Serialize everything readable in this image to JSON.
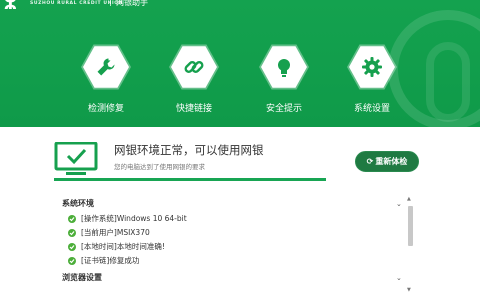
{
  "header": {
    "logo_text": "SUZHOU RURAL CREDIT UNION",
    "subtitle": "网银助手",
    "colors": {
      "brand": "#14a24f",
      "white": "#ffffff"
    }
  },
  "tools": [
    {
      "label": "检测修复",
      "icon": "wrench-icon"
    },
    {
      "label": "快捷链接",
      "icon": "link-icon"
    },
    {
      "label": "安全提示",
      "icon": "lightbulb-icon"
    },
    {
      "label": "系统设置",
      "icon": "gear-icon"
    }
  ],
  "status": {
    "title": "网银环境正常，可以使用网银",
    "subtitle": "您的电脑达到了使用网银的要求",
    "recheck_label": "重新体检",
    "progress": 1.0
  },
  "sections": [
    {
      "title": "系统环境",
      "items": [
        "[操作系统]Windows 10 64-bit",
        "[当前用户]MSIX370",
        "[本地时间]本地时间准确!",
        "[证书链]修复成功"
      ]
    },
    {
      "title": "浏览器设置",
      "items": []
    }
  ]
}
